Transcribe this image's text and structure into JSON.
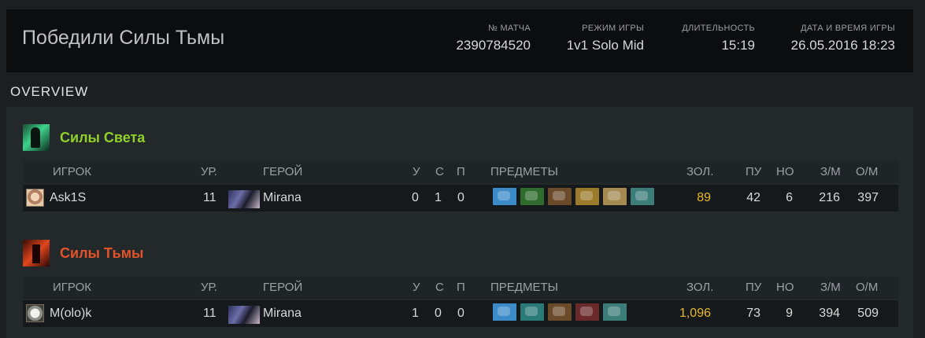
{
  "match": {
    "result_title": "Победили Силы Тьмы",
    "id_label": "№ МАТЧА",
    "id": "2390784520",
    "mode_label": "РЕЖИМ ИГРЫ",
    "mode": "1v1 Solo Mid",
    "duration_label": "ДЛИТЕЛЬНОСТЬ",
    "duration": "15:19",
    "date_label": "ДАТА И ВРЕМЯ ИГРЫ",
    "date": "26.05.2016 18:23"
  },
  "section_title": "OVERVIEW",
  "columns": {
    "player": "ИГРОК",
    "level": "УР.",
    "hero": "ГЕРОЙ",
    "kills": "У",
    "deaths": "С",
    "assists": "П",
    "items": "ПРЕДМЕТЫ",
    "gold": "ЗОЛ.",
    "last_hits": "ПУ",
    "denies": "НО",
    "gpm": "З/М",
    "xpm": "О/М"
  },
  "teams": [
    {
      "name": "Силы Света",
      "name_color": "#8fd12a",
      "icon": "radiant-icon",
      "players": [
        {
          "name": "Ask1S",
          "level": "11",
          "hero": "Mirana",
          "kills": "0",
          "deaths": "1",
          "assists": "0",
          "items": [
            {
              "icon": "item-crystal-icon",
              "color": "#3a8bc7"
            },
            {
              "icon": "item-slippers-icon",
              "color": "#2f6b2c"
            },
            {
              "icon": "item-boots-icon",
              "color": "#6b4a2a"
            },
            {
              "icon": "item-claws-icon",
              "color": "#9b7a2a"
            },
            {
              "icon": "item-scroll-icon",
              "color": "#a58a52"
            },
            {
              "icon": "item-wraith-icon",
              "color": "#3d7d79"
            }
          ],
          "gold": "89",
          "last_hits": "42",
          "denies": "6",
          "gpm": "216",
          "xpm": "397"
        }
      ]
    },
    {
      "name": "Силы Тьмы",
      "name_color": "#e2532a",
      "icon": "dire-icon",
      "players": [
        {
          "name": "M(olo)k",
          "level": "11",
          "hero": "Mirana",
          "kills": "1",
          "deaths": "0",
          "assists": "0",
          "items": [
            {
              "icon": "item-crystal-icon",
              "color": "#3a8bc7"
            },
            {
              "icon": "item-bottle-icon",
              "color": "#2a7a78"
            },
            {
              "icon": "item-boots-icon",
              "color": "#6b4a2a"
            },
            {
              "icon": "item-mask-icon",
              "color": "#6b2a2a"
            },
            {
              "icon": "item-wraith-icon",
              "color": "#3d7d79"
            }
          ],
          "gold": "1,096",
          "last_hits": "73",
          "denies": "9",
          "gpm": "394",
          "xpm": "509"
        }
      ]
    }
  ]
}
